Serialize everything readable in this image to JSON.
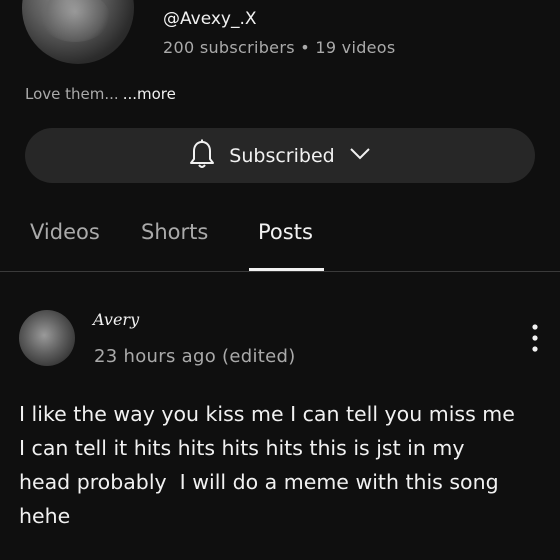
{
  "channel": {
    "handle": "@Avexy_.X",
    "stats": "200 subscribers • 19 videos",
    "description": "Love them...",
    "more_label": "...more"
  },
  "subscribe": {
    "label": "Subscribed",
    "bell_icon": "bell-icon",
    "chevron_icon": "chevron-down-icon"
  },
  "tabs": [
    {
      "label": "Videos"
    },
    {
      "label": "Shorts"
    },
    {
      "label": "Posts",
      "active": true
    }
  ],
  "post": {
    "author": "Avery",
    "time": "23 hours ago (edited)",
    "text": "I like the way you kiss me I can tell you miss me\nI can tell it hits hits hits hits this is jst in my\nhead probably  I will do a meme with this song\nhehe",
    "menu_icon": "more-vert-icon"
  },
  "colors": {
    "background": "#0f0f0f",
    "button": "#272727",
    "primary_text": "#f1f1f1",
    "secondary_text": "#aaaaaa"
  }
}
